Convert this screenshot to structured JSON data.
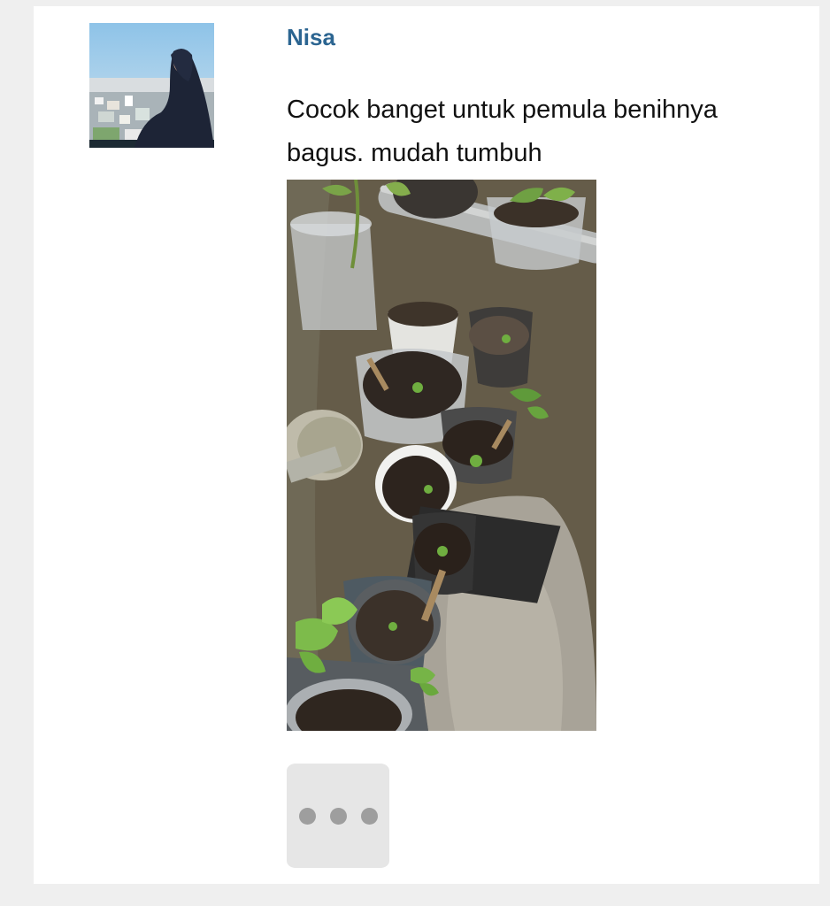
{
  "review": {
    "author_name": "Nisa",
    "text": "Cocok banget untuk pemula benihnya bagus. mudah tumbuh",
    "avatar_icon": "user-avatar-photo",
    "photo_icon": "potted-seedlings-photo",
    "more_icon": "ellipsis-icon"
  },
  "colors": {
    "author_link": "#2c6591",
    "page_background": "#efefef",
    "card_background": "#ffffff",
    "more_button_bg": "#e6e6e6",
    "more_dots": "#9e9e9e"
  }
}
